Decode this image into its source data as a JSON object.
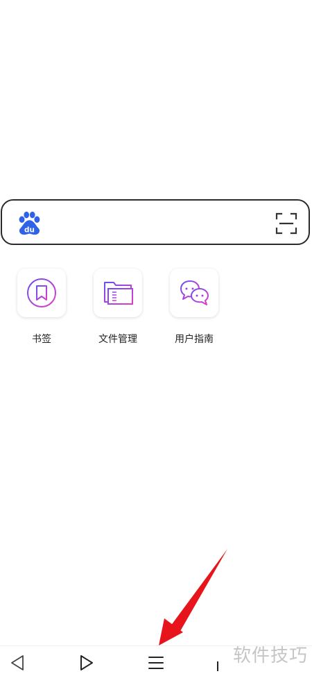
{
  "search": {
    "placeholder": "",
    "value": ""
  },
  "shortcuts": [
    {
      "label": "书签",
      "icon": "bookmark-icon"
    },
    {
      "label": "文件管理",
      "icon": "folder-icon"
    },
    {
      "label": "用户指南",
      "icon": "chat-bubbles-icon"
    }
  ],
  "bottom_nav": [
    {
      "icon": "back-icon"
    },
    {
      "icon": "forward-icon"
    },
    {
      "icon": "menu-icon"
    },
    {
      "icon": "tabs-icon"
    }
  ],
  "annotation": {
    "type": "red-arrow",
    "points_to": "menu-icon",
    "color": "#e8141c"
  },
  "watermark": {
    "text": "软件技巧"
  },
  "colors": {
    "baidu_blue": "#2f62e8",
    "icon_gradient_start": "#6b4cf5",
    "icon_gradient_end": "#e23cc8"
  }
}
